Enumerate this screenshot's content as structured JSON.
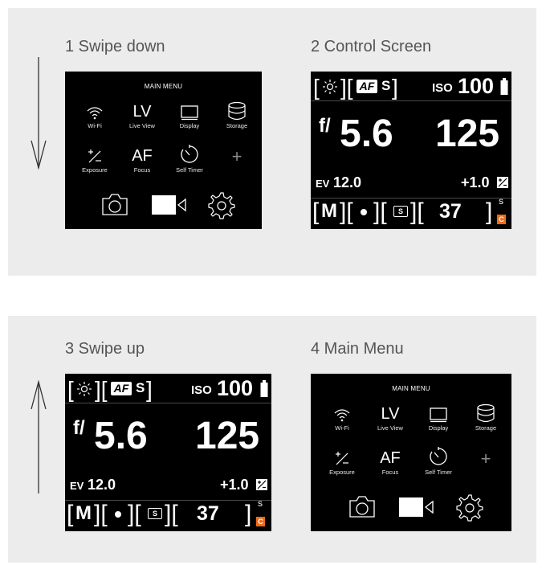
{
  "steps": {
    "step1": {
      "label": "1  Swipe down"
    },
    "step2": {
      "label": "2  Control Screen"
    },
    "step3": {
      "label": "3  Swipe up"
    },
    "step4": {
      "label": "4  Main Menu"
    }
  },
  "main_menu": {
    "title": "MAIN MENU",
    "items": [
      {
        "icon": "wifi-icon",
        "label": "Wi-Fi"
      },
      {
        "icon": "LV",
        "label": "Live View"
      },
      {
        "icon": "display-icon",
        "label": "Display"
      },
      {
        "icon": "storage-icon",
        "label": "Storage"
      },
      {
        "icon": "exposure-icon",
        "label": "Exposure"
      },
      {
        "icon": "AF",
        "label": "Focus"
      },
      {
        "icon": "self-timer-icon",
        "label": "Self Timer"
      },
      {
        "icon": "plus-icon",
        "label": "+"
      }
    ],
    "bottom_icons": [
      "camera-icon",
      "video-icon",
      "settings-icon"
    ]
  },
  "control_screen": {
    "white_balance_icon": "sun-icon",
    "af_badge": "AF",
    "af_mode": "S",
    "iso_label": "ISO",
    "iso_value": "100",
    "battery_icon": "battery-icon",
    "aperture_prefix": "f/",
    "aperture_value": "5.6",
    "shutter_value": "125",
    "ev_label": "EV",
    "ev_value": "12.0",
    "exposure_comp": "+1.0",
    "exposure_comp_icon": "exposure-comp-icon",
    "mode": "M",
    "metering_icon": "spot-meter-icon",
    "drive_badge": "S",
    "shots_remaining": "37",
    "storage_letter": "S",
    "card_letter": "C",
    "accent_color": "#f06a17"
  }
}
